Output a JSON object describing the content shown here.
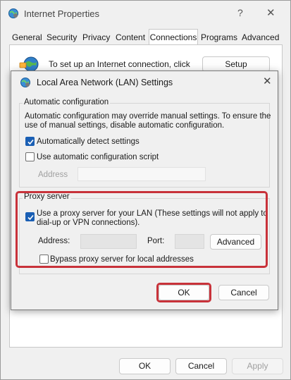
{
  "window": {
    "title": "Internet Properties",
    "help": "?",
    "close": "✕"
  },
  "tabs": [
    "General",
    "Security",
    "Privacy",
    "Content",
    "Connections",
    "Programs",
    "Advanced"
  ],
  "connections": {
    "setup_text": "To set up an Internet connection, click",
    "setup_button": "Setup"
  },
  "lan": {
    "title": "Local Area Network (LAN) Settings",
    "close": "✕",
    "auto_group_label": "Automatic configuration",
    "auto_desc_line1": "Automatic configuration may override manual settings.  To ensure the",
    "auto_desc_line2": "use of manual settings, disable automatic configuration.",
    "auto_detect_label": "Automatically detect settings",
    "auto_detect_checked": true,
    "auto_script_label": "Use automatic configuration script",
    "auto_script_checked": false,
    "auto_address_label": "Address",
    "proxy_group_label": "Proxy server",
    "proxy_use_line1": "Use a proxy server for your LAN (These settings will not apply to",
    "proxy_use_line2": "dial-up or VPN connections).",
    "proxy_use_checked": true,
    "proxy_address_label": "Address:",
    "proxy_port_label": "Port:",
    "proxy_advanced_button": "Advanced",
    "bypass_label": "Bypass proxy server for local addresses",
    "bypass_checked": false,
    "ok_button": "OK",
    "cancel_button": "Cancel"
  },
  "footer": {
    "ok": "OK",
    "cancel": "Cancel",
    "apply": "Apply"
  },
  "colors": {
    "highlight": "#c8323a",
    "checkbox": "#1a5fb4"
  }
}
